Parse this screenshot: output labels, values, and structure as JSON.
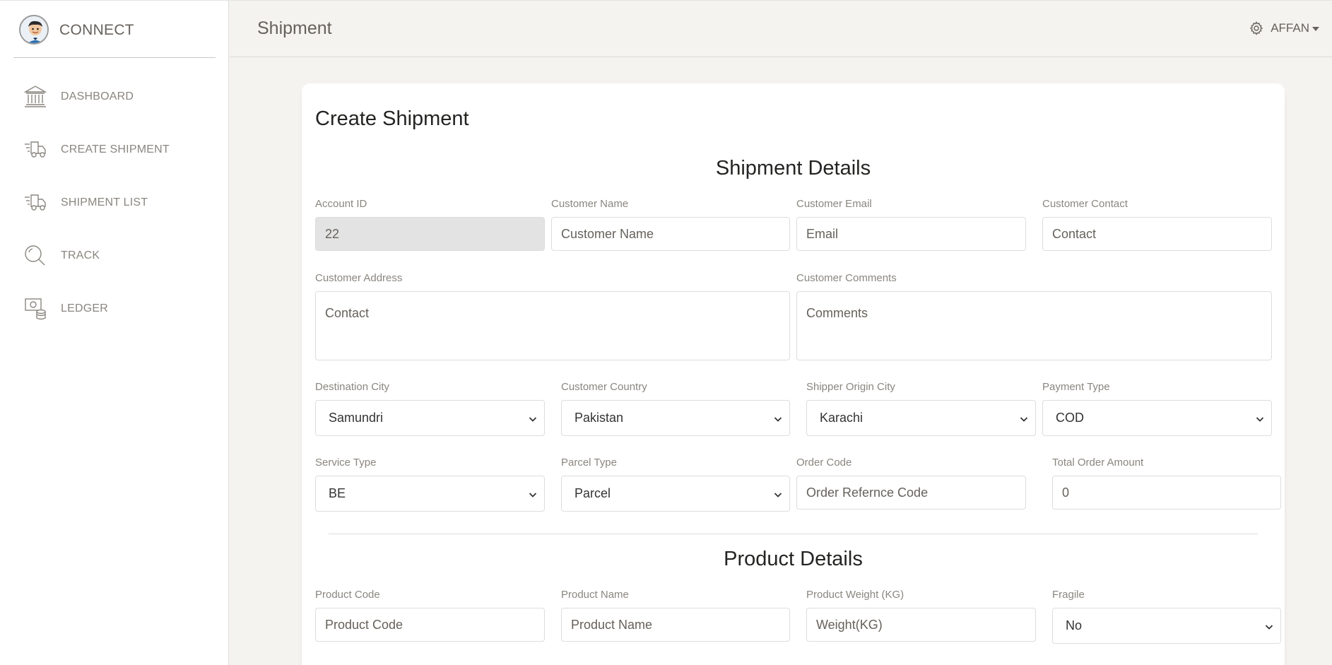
{
  "sidebar": {
    "brand": "CONNECT",
    "items": [
      {
        "label": "DASHBOARD",
        "icon": "bank-icon"
      },
      {
        "label": "CREATE SHIPMENT",
        "icon": "delivery-truck-icon"
      },
      {
        "label": "SHIPMENT LIST",
        "icon": "delivery-truck-icon"
      },
      {
        "label": "TRACK",
        "icon": "search-icon"
      },
      {
        "label": "LEDGER",
        "icon": "money-coins-icon"
      }
    ]
  },
  "navbar": {
    "title": "Shipment",
    "user": "AFFAN"
  },
  "card": {
    "title": "Create Shipment",
    "shipment_section": "Shipment Details",
    "product_section": "Product Details"
  },
  "fields": {
    "account_id": {
      "label": "Account ID",
      "value": "22"
    },
    "customer_name": {
      "label": "Customer Name",
      "placeholder": "Customer Name"
    },
    "customer_email": {
      "label": "Customer Email",
      "placeholder": "Email"
    },
    "customer_contact": {
      "label": "Customer Contact",
      "placeholder": "Contact"
    },
    "customer_address": {
      "label": "Customer Address",
      "placeholder": "Contact"
    },
    "customer_comments": {
      "label": "Customer Comments",
      "placeholder": "Comments"
    },
    "destination_city": {
      "label": "Destination City",
      "value": "Samundri"
    },
    "customer_country": {
      "label": "Customer Country",
      "value": "Pakistan"
    },
    "origin_city": {
      "label": "Shipper Origin City",
      "value": "Karachi"
    },
    "payment_type": {
      "label": "Payment Type",
      "value": "COD"
    },
    "service_type": {
      "label": "Service Type",
      "value": "BE"
    },
    "parcel_type": {
      "label": "Parcel Type",
      "value": "Parcel"
    },
    "order_code": {
      "label": "Order Code",
      "placeholder": "Order Refernce Code"
    },
    "total_amount": {
      "label": "Total Order Amount",
      "value": "0"
    },
    "product_code": {
      "label": "Product Code",
      "placeholder": "Product Code"
    },
    "product_name": {
      "label": "Product Name",
      "placeholder": "Product Name"
    },
    "product_weight": {
      "label": "Product Weight (KG)",
      "placeholder": "Weight(KG)"
    },
    "fragile": {
      "label": "Fragile",
      "value": "No"
    }
  }
}
